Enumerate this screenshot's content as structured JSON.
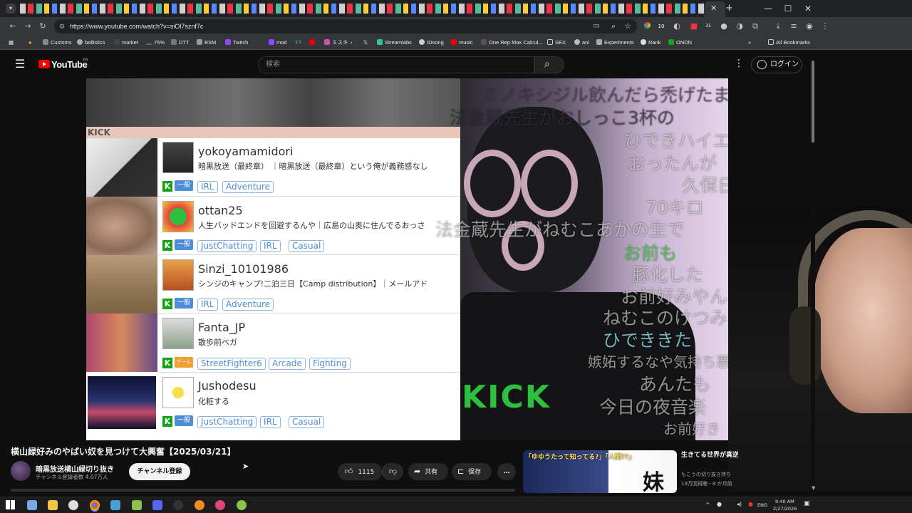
{
  "browser": {
    "url": "https://www.youtube.com/watch?v=siOl7sznf7c",
    "bookmarks": [
      "Customs",
      "ballistics",
      "market",
      "75%",
      "DTT",
      "BSM",
      "Twitch",
      "mod",
      "ミスキ",
      "Streamlabs",
      "IDsong",
      "music",
      "One Rep Max Calcul...",
      "SEX",
      "ani",
      "Experiments",
      "Rank",
      "ONDN"
    ],
    "all_bookmarks": "All Bookmarks",
    "badge_count": "10",
    "notif_count": "31"
  },
  "youtube": {
    "logo_text": "YouTube",
    "region": "FR",
    "search_placeholder": "検索",
    "login_label": "ログイン"
  },
  "stream_list": [
    {
      "name": "yokoyamamidori",
      "desc": "暗黒放送（最終章）  ｜暗黒放送（最終章）という俺が義務感なし",
      "category": "一般",
      "tags": [
        "IRL",
        "Adventure"
      ]
    },
    {
      "name": "ottan25",
      "desc": "人生バッドエンドを回避するんや｜広島の山奥に住んでるおっさ",
      "category": "一般",
      "tags": [
        "JustChatting",
        "IRL",
        "Casual"
      ]
    },
    {
      "name": "Sinzi_10101986",
      "desc": "シンジのキャンプ!二泊三日【Camp distribution】｜メールアド",
      "category": "一般",
      "tags": [
        "IRL",
        "Adventure"
      ]
    },
    {
      "name": "Fanta_JP",
      "desc": "散歩前ベガ",
      "category": "ゲーム",
      "tags": [
        "StreetFighter6",
        "Arcade",
        "Fighting"
      ]
    },
    {
      "name": "Jushodesu",
      "desc": "化粧する",
      "category": "一般",
      "tags": [
        "JustChatting",
        "IRL",
        "Casual"
      ]
    }
  ],
  "overlay": {
    "kick_header": "KICK",
    "shirt_print": "KICK",
    "danmaku": [
      "ミノキシジル飲んだら禿げたま",
      "法金蔵先生がおしっこ3杯の",
      "ひできハイエ",
      "おったんが",
      "久保日",
      "70キロ",
      "法金蔵先生がねむこあかの生で",
      "お前も",
      "豚化した",
      "お前好みやん",
      "ねむこのけつみ",
      "ひでききた",
      "嫉妬するなや気持ち悪",
      "あんたも",
      "今日の夜音楽",
      "お前好き"
    ]
  },
  "video": {
    "title": "横山緑好みのやばい奴を見つけて大興奮【2025/03/21】",
    "channel_name": "暗黒放送横山緑切り抜き",
    "channel_subs": "チャンネル登録者数 4.07万人",
    "subscribe_label": "チャンネル登録",
    "like_count": "1115",
    "share_label": "共有",
    "save_label": "保存"
  },
  "recommended": {
    "thumb_text_1": "「ゆゆうたって知ってる?」「人間??」",
    "thumb_text_2": "妹",
    "title": "生きてる世界が真逆 妹の雑談配信ダイジ",
    "channel": "もこうの切り抜き持ち",
    "meta": "19万回視聴・8 か月前"
  },
  "taskbar": {
    "lang": "ENG",
    "time": "9:40 AM",
    "date": "2/27/2026"
  },
  "colors": {
    "yt_red": "#ff0000",
    "kick_green": "#15a315",
    "tag_blue": "#4d8ed8"
  }
}
